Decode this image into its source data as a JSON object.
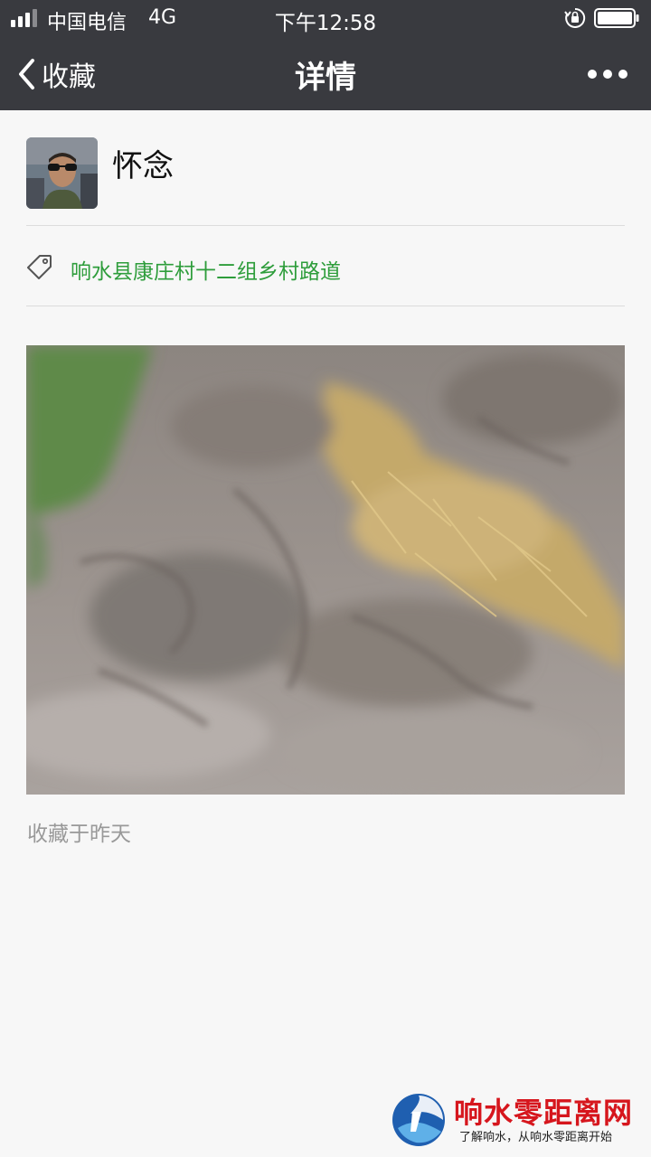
{
  "status_bar": {
    "carrier": "中国电信",
    "network": "4G",
    "time": "下午12:58"
  },
  "nav": {
    "back_label": "收藏",
    "title": "详情"
  },
  "post": {
    "author": "怀念",
    "location": "响水县康庄村十二组乡村路道",
    "saved_time": "收藏于昨天"
  },
  "watermark": {
    "name": "响水零距离网",
    "tagline": "了解响水，从响水零距离开始"
  },
  "icons": [
    "signal-icon",
    "lock-rotation-icon",
    "battery-icon",
    "back-chevron-icon",
    "more-icon",
    "tag-icon"
  ],
  "colors": {
    "nav_bg": "#393a3f",
    "location_link": "#2e9d3b",
    "watermark_red": "#d6161d"
  }
}
